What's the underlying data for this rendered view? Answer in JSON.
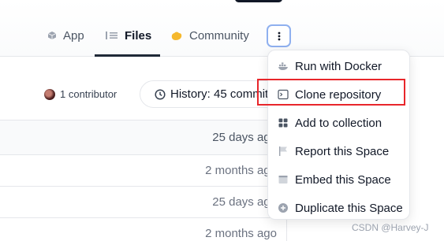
{
  "tabs": [
    {
      "label": "App",
      "icon": "cube-icon"
    },
    {
      "label": "Files",
      "icon": "files-icon",
      "active": true
    },
    {
      "label": "Community",
      "icon": "community-icon"
    }
  ],
  "more_button": {
    "icon": "vertical-dots-icon"
  },
  "contributors": {
    "label": "1 contributor"
  },
  "history": {
    "label": "History: 45 commits"
  },
  "file_rows": [
    "25 days ago",
    "2 months ago",
    "25 days ago",
    "2 months ago"
  ],
  "menu": {
    "items": [
      {
        "label": "Run with Docker",
        "icon": "docker-icon"
      },
      {
        "label": "Clone repository",
        "icon": "terminal-icon"
      },
      {
        "label": "Add to collection",
        "icon": "collection-icon"
      },
      {
        "label": "Report this Space",
        "icon": "flag-icon"
      },
      {
        "label": "Embed this Space",
        "icon": "embed-icon"
      },
      {
        "label": "Duplicate this Space",
        "icon": "duplicate-icon"
      }
    ]
  },
  "highlight_color": "#e8262b",
  "watermark": "CSDN @Harvey-J"
}
